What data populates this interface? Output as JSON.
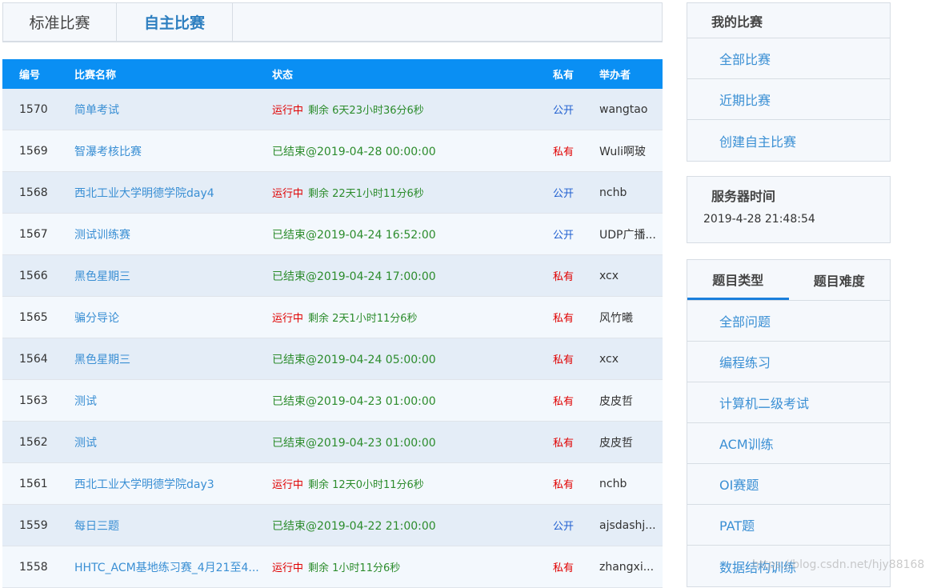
{
  "tabs": [
    "标准比赛",
    "自主比赛"
  ],
  "table": {
    "headers": {
      "id": "编号",
      "name": "比赛名称",
      "status": "状态",
      "privacy": "私有",
      "host": "举办者"
    },
    "rows": [
      {
        "id": "1570",
        "name": "简单考试",
        "running": true,
        "tag": "运行中",
        "status": "剩余 6天23小时36分6秒",
        "privacy": "公开",
        "public": true,
        "host": "wangtao"
      },
      {
        "id": "1569",
        "name": "智瀑考核比赛",
        "running": false,
        "status": "已结束@2019-04-28 00:00:00",
        "privacy": "私有",
        "public": false,
        "host": "Wuli啊玻"
      },
      {
        "id": "1568",
        "name": "西北工业大学明德学院day4",
        "running": true,
        "tag": "运行中",
        "status": "剩余 22天1小时11分6秒",
        "privacy": "公开",
        "public": true,
        "host": "nchb"
      },
      {
        "id": "1567",
        "name": "测试训练赛",
        "running": false,
        "status": "已结束@2019-04-24 16:52:00",
        "privacy": "公开",
        "public": true,
        "host": "UDP广播..."
      },
      {
        "id": "1566",
        "name": "黑色星期三",
        "running": false,
        "status": "已结束@2019-04-24 17:00:00",
        "privacy": "私有",
        "public": false,
        "host": "xcx"
      },
      {
        "id": "1565",
        "name": "骗分导论",
        "running": true,
        "tag": "运行中",
        "status": "剩余 2天1小时11分6秒",
        "privacy": "私有",
        "public": false,
        "host": "风竹曦"
      },
      {
        "id": "1564",
        "name": "黑色星期三",
        "running": false,
        "status": "已结束@2019-04-24 05:00:00",
        "privacy": "私有",
        "public": false,
        "host": "xcx"
      },
      {
        "id": "1563",
        "name": "测试",
        "running": false,
        "status": "已结束@2019-04-23 01:00:00",
        "privacy": "私有",
        "public": false,
        "host": "皮皮哲"
      },
      {
        "id": "1562",
        "name": "测试",
        "running": false,
        "status": "已结束@2019-04-23 01:00:00",
        "privacy": "私有",
        "public": false,
        "host": "皮皮哲"
      },
      {
        "id": "1561",
        "name": "西北工业大学明德学院day3",
        "running": true,
        "tag": "运行中",
        "status": "剩余 12天0小时11分6秒",
        "privacy": "私有",
        "public": false,
        "host": "nchb"
      },
      {
        "id": "1559",
        "name": "每日三题",
        "running": false,
        "status": "已结束@2019-04-22 21:00:00",
        "privacy": "公开",
        "public": true,
        "host": "ajsdashj..."
      },
      {
        "id": "1558",
        "name": "HHTC_ACM基地练习赛_4月21至4...",
        "running": true,
        "tag": "运行中",
        "status": "剩余 1小时11分6秒",
        "privacy": "私有",
        "public": false,
        "host": "zhangxi..."
      }
    ]
  },
  "my_contests": {
    "title": "我的比赛",
    "items": [
      "全部比赛",
      "近期比赛",
      "创建自主比赛"
    ]
  },
  "server_time": {
    "title": "服务器时间",
    "value": "2019-4-28 21:48:54"
  },
  "problem_panel": {
    "tabs": [
      "题目类型",
      "题目难度"
    ],
    "items": [
      "全部问题",
      "编程练习",
      "计算机二级考试",
      "ACM训练",
      "OI赛题",
      "PAT题",
      "数据结构训练"
    ]
  },
  "watermark": "https://blog.csdn.net/hjy88168",
  "colors": {
    "header_blue": "#0a8ff3",
    "link": "#3a8fd4",
    "running_red": "#e00000",
    "ended_green": "#2c8c2c",
    "public_blue": "#1f5fd0"
  }
}
